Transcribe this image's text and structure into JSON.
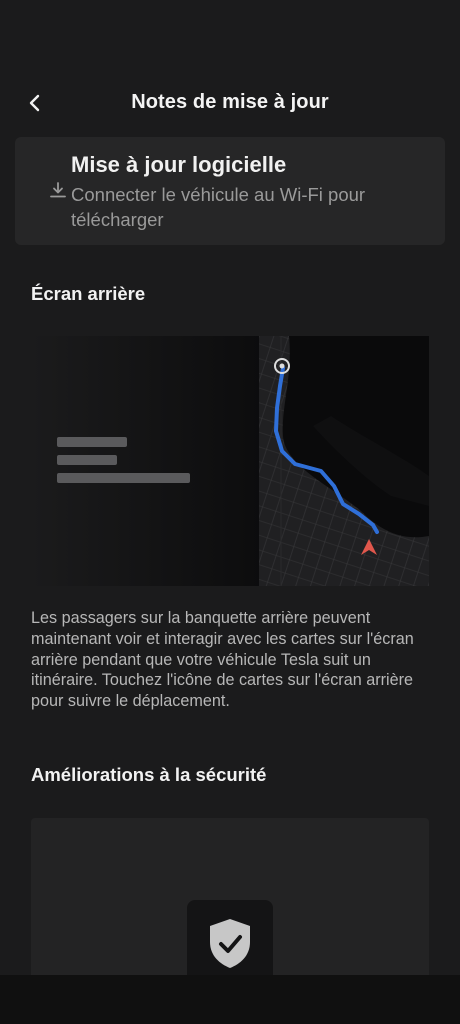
{
  "header": {
    "title": "Notes de mise à jour",
    "back_icon": "chevron-left-icon"
  },
  "update_card": {
    "icon": "download-icon",
    "title": "Mise à jour logicielle",
    "subtitle": "Connecter le véhicule au Wi-Fi pour télécharger"
  },
  "section_rear_screen": {
    "title": "Écran arrière",
    "image": "rear-screen-map-preview",
    "description": "Les passagers sur la banquette arrière peuvent maintenant voir et interagir avec les cartes sur l'écran arrière pendant que votre véhicule Tesla suit un itinéraire.  Touchez l'icône de cartes sur l'écran arrière pour suivre le déplacement."
  },
  "section_security": {
    "title": "Améliorations à la sécurité",
    "icon": "shield-check-icon"
  },
  "colors": {
    "background": "#1b1b1c",
    "card": "#262627",
    "route": "#2f6fd8",
    "car_marker": "#e0574c"
  }
}
